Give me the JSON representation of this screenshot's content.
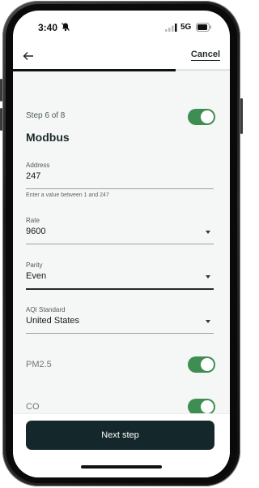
{
  "status_bar": {
    "time": "3:40",
    "network": "5G",
    "icons": [
      "bell-slash-icon",
      "signal-icon",
      "battery-icon"
    ]
  },
  "header": {
    "back_icon": "arrow-left-icon",
    "cancel_label": "Cancel",
    "progress_fraction": 0.75
  },
  "step": {
    "label": "Step 6 of 8",
    "enabled": true
  },
  "section_title": "Modbus",
  "fields": {
    "address": {
      "label": "Address",
      "value": "247",
      "helper": "Enter a value between 1 and 247"
    },
    "rate": {
      "label": "Rate",
      "value": "9600"
    },
    "parity": {
      "label": "Parity",
      "value": "Even"
    },
    "aqi_standard": {
      "label": "AQI Standard",
      "value": "United States"
    }
  },
  "toggles": {
    "pm25": {
      "label": "PM2.5",
      "enabled": true
    },
    "co": {
      "label": "CO",
      "enabled": true
    }
  },
  "footer": {
    "next_label": "Next step"
  },
  "colors": {
    "toggle_on": "#3e8e53",
    "button_bg": "#14272a",
    "content_bg": "#f5f6f6"
  }
}
